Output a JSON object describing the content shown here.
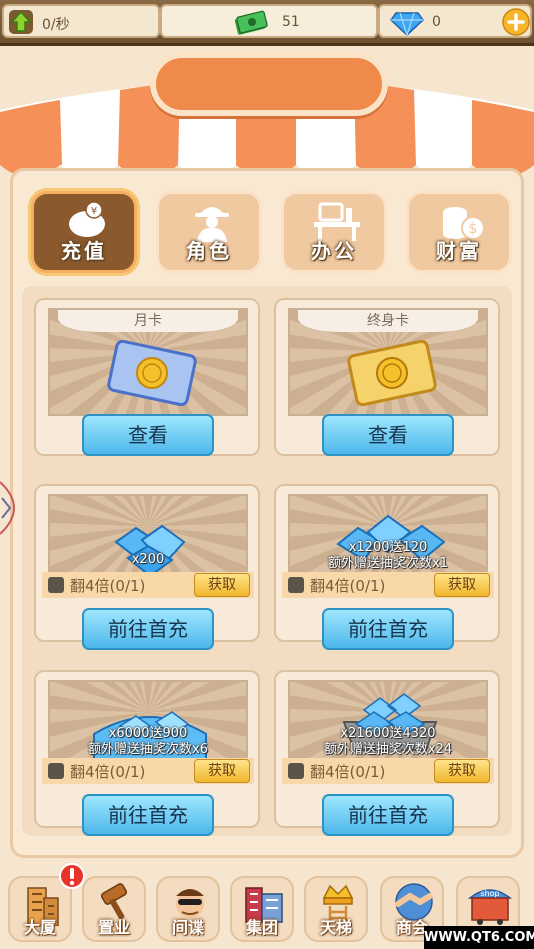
{
  "topbar": {
    "rate": "0/秒",
    "cash": "51",
    "diamonds": "0"
  },
  "tabs": [
    {
      "label": "充值",
      "icon": "piggy-bank-icon",
      "active": true
    },
    {
      "label": "角色",
      "icon": "spy-icon",
      "active": false
    },
    {
      "label": "办公",
      "icon": "office-desk-icon",
      "active": false
    },
    {
      "label": "财富",
      "icon": "coin-stack-icon",
      "active": false
    }
  ],
  "cards": {
    "monthly": {
      "title": "月卡",
      "button": "查看"
    },
    "lifetime": {
      "title": "终身卡",
      "button": "查看"
    }
  },
  "offers": [
    {
      "amount": "x200",
      "bonus": "",
      "double": "翻4倍(0/1)",
      "claim": "获取",
      "button": "前往首充"
    },
    {
      "amount": "x1200送120",
      "bonus": "额外赠送抽奖次数x1",
      "double": "翻4倍(0/1)",
      "claim": "获取",
      "button": "前往首充"
    },
    {
      "amount": "x6000送900",
      "bonus": "额外赠送抽奖次数x6",
      "double": "翻4倍(0/1)",
      "claim": "获取",
      "button": "前往首充"
    },
    {
      "amount": "x21600送4320",
      "bonus": "额外赠送抽奖次数x24",
      "double": "翻4倍(0/1)",
      "claim": "获取",
      "button": "前往首充"
    }
  ],
  "nav": [
    {
      "label": "大厦",
      "icon": "building-icon"
    },
    {
      "label": "置业",
      "icon": "gavel-icon"
    },
    {
      "label": "间谍",
      "icon": "spy-face-icon"
    },
    {
      "label": "集团",
      "icon": "corporation-icon"
    },
    {
      "label": "天梯",
      "icon": "ladder-crown-icon"
    },
    {
      "label": "商会",
      "icon": "handshake-icon"
    },
    {
      "label": "shop",
      "icon": "shop-cart-icon"
    }
  ],
  "watermark": "WWW.QT6.COM",
  "colors": {
    "accent": "#4cb7ea",
    "tab_active": "#8a5a2e",
    "awning": "#f08a4a"
  }
}
